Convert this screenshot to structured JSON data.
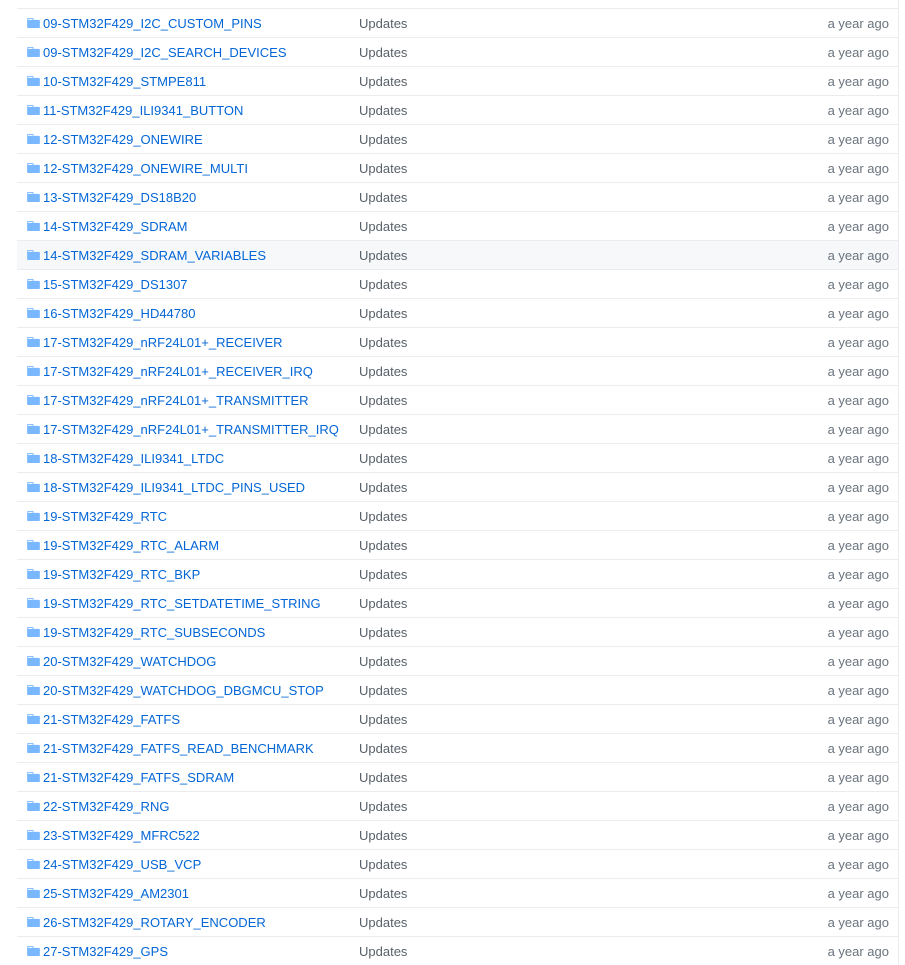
{
  "colors": {
    "link": "#0366d6",
    "folder_icon": "#79b8ff",
    "row_border": "#eaecef",
    "row_highlight": "#f6f8fa"
  },
  "icon_name": "folder-icon",
  "rows": [
    {
      "name": "",
      "message": "",
      "age": ""
    },
    {
      "name": "09-STM32F429_I2C_CUSTOM_PINS",
      "message": "Updates",
      "age": "a year ago"
    },
    {
      "name": "09-STM32F429_I2C_SEARCH_DEVICES",
      "message": "Updates",
      "age": "a year ago"
    },
    {
      "name": "10-STM32F429_STMPE811",
      "message": "Updates",
      "age": "a year ago"
    },
    {
      "name": "11-STM32F429_ILI9341_BUTTON",
      "message": "Updates",
      "age": "a year ago"
    },
    {
      "name": "12-STM32F429_ONEWIRE",
      "message": "Updates",
      "age": "a year ago"
    },
    {
      "name": "12-STM32F429_ONEWIRE_MULTI",
      "message": "Updates",
      "age": "a year ago"
    },
    {
      "name": "13-STM32F429_DS18B20",
      "message": "Updates",
      "age": "a year ago"
    },
    {
      "name": "14-STM32F429_SDRAM",
      "message": "Updates",
      "age": "a year ago"
    },
    {
      "name": "14-STM32F429_SDRAM_VARIABLES",
      "message": "Updates",
      "age": "a year ago"
    },
    {
      "name": "15-STM32F429_DS1307",
      "message": "Updates",
      "age": "a year ago"
    },
    {
      "name": "16-STM32F429_HD44780",
      "message": "Updates",
      "age": "a year ago"
    },
    {
      "name": "17-STM32F429_nRF24L01+_RECEIVER",
      "message": "Updates",
      "age": "a year ago"
    },
    {
      "name": "17-STM32F429_nRF24L01+_RECEIVER_IRQ",
      "message": "Updates",
      "age": "a year ago"
    },
    {
      "name": "17-STM32F429_nRF24L01+_TRANSMITTER",
      "message": "Updates",
      "age": "a year ago"
    },
    {
      "name": "17-STM32F429_nRF24L01+_TRANSMITTER_IRQ",
      "message": "Updates",
      "age": "a year ago"
    },
    {
      "name": "18-STM32F429_ILI9341_LTDC",
      "message": "Updates",
      "age": "a year ago"
    },
    {
      "name": "18-STM32F429_ILI9341_LTDC_PINS_USED",
      "message": "Updates",
      "age": "a year ago"
    },
    {
      "name": "19-STM32F429_RTC",
      "message": "Updates",
      "age": "a year ago"
    },
    {
      "name": "19-STM32F429_RTC_ALARM",
      "message": "Updates",
      "age": "a year ago"
    },
    {
      "name": "19-STM32F429_RTC_BKP",
      "message": "Updates",
      "age": "a year ago"
    },
    {
      "name": "19-STM32F429_RTC_SETDATETIME_STRING",
      "message": "Updates",
      "age": "a year ago"
    },
    {
      "name": "19-STM32F429_RTC_SUBSECONDS",
      "message": "Updates",
      "age": "a year ago"
    },
    {
      "name": "20-STM32F429_WATCHDOG",
      "message": "Updates",
      "age": "a year ago"
    },
    {
      "name": "20-STM32F429_WATCHDOG_DBGMCU_STOP",
      "message": "Updates",
      "age": "a year ago"
    },
    {
      "name": "21-STM32F429_FATFS",
      "message": "Updates",
      "age": "a year ago"
    },
    {
      "name": "21-STM32F429_FATFS_READ_BENCHMARK",
      "message": "Updates",
      "age": "a year ago"
    },
    {
      "name": "21-STM32F429_FATFS_SDRAM",
      "message": "Updates",
      "age": "a year ago"
    },
    {
      "name": "22-STM32F429_RNG",
      "message": "Updates",
      "age": "a year ago"
    },
    {
      "name": "23-STM32F429_MFRC522",
      "message": "Updates",
      "age": "a year ago"
    },
    {
      "name": "24-STM32F429_USB_VCP",
      "message": "Updates",
      "age": "a year ago"
    },
    {
      "name": "25-STM32F429_AM2301",
      "message": "Updates",
      "age": "a year ago"
    },
    {
      "name": "26-STM32F429_ROTARY_ENCODER",
      "message": "Updates",
      "age": "a year ago"
    },
    {
      "name": "27-STM32F429_GPS",
      "message": "Updates",
      "age": "a year ago"
    }
  ],
  "highlighted_row": "14-STM32F429_SDRAM_VARIABLES"
}
